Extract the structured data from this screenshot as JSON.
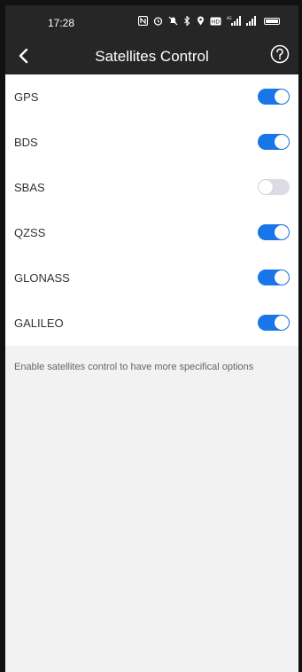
{
  "status_bar": {
    "time": "17:28",
    "icons": [
      "nfc-icon",
      "alarm-icon",
      "mute-icon",
      "bluetooth-icon",
      "location-icon",
      "hd-icon",
      "4g-signal-icon",
      "signal-icon",
      "battery-icon"
    ]
  },
  "header": {
    "title": "Satellites Control",
    "back_icon": "chevron-left-icon",
    "help_icon": "help-circle-icon"
  },
  "satellites": [
    {
      "label": "GPS",
      "enabled": true
    },
    {
      "label": "BDS",
      "enabled": true
    },
    {
      "label": "SBAS",
      "enabled": false
    },
    {
      "label": "QZSS",
      "enabled": true
    },
    {
      "label": "GLONASS",
      "enabled": true
    },
    {
      "label": "GALILEO",
      "enabled": true
    }
  ],
  "note": "Enable satellites control to have more specifical options",
  "colors": {
    "accent": "#1976e8",
    "toggle_off": "#dcdce6",
    "header_bg": "#262626"
  }
}
